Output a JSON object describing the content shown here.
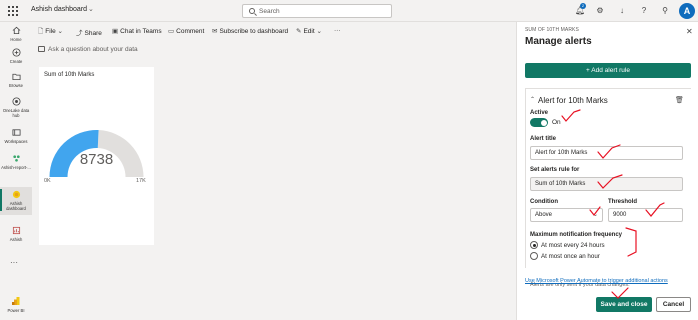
{
  "app": {
    "title": "Ashish dashboard"
  },
  "search": {
    "placeholder": "Search"
  },
  "header": {
    "notification_count": "2",
    "avatar_initial": "A"
  },
  "rail": {
    "items": [
      {
        "label": "Home"
      },
      {
        "label": "Create"
      },
      {
        "label": "Browse"
      },
      {
        "label": "OneLake data hub"
      },
      {
        "label": "Workspaces"
      },
      {
        "label": "Ashish-report-..."
      },
      {
        "label": "Ashish dashboard"
      },
      {
        "label": "Ashish"
      }
    ],
    "more": "···",
    "product": "Power BI"
  },
  "toolbar": {
    "file": "File",
    "share": "Share",
    "chat": "Chat in Teams",
    "comment": "Comment",
    "subscribe": "Subscribe to dashboard",
    "edit": "Edit",
    "more": "···"
  },
  "qa": {
    "placeholder": "Ask a question about your data"
  },
  "tile": {
    "title": "Sum of 10th Marks",
    "value": "8738",
    "min_label": "0K",
    "max_label": "17K",
    "fill_fraction": 0.514,
    "color": "#41a5ee"
  },
  "panel": {
    "subtitle": "SUM OF 10TH MARKS",
    "title": "Manage alerts",
    "add_rule": "+ Add alert rule",
    "rule": {
      "name": "Alert for 10th Marks",
      "active_label": "Active",
      "toggle_text": "On",
      "alert_title_label": "Alert title",
      "alert_title_value": "Alert for 10th Marks",
      "set_rule_label": "Set alerts rule for",
      "set_rule_value": "Sum of 10th Marks",
      "condition_label": "Condition",
      "condition_value": "Above",
      "threshold_label": "Threshold",
      "threshold_value": "9000",
      "frequency_label": "Maximum notification frequency",
      "frequency_options": [
        "At most every 24 hours",
        "At most once an hour"
      ],
      "hint": "Alerts are only sent if your data changes."
    },
    "power_automate_link": "Use Microsoft Power Automate to trigger additional actions",
    "save": "Save and close",
    "cancel": "Cancel"
  },
  "colors": {
    "accent": "#117865",
    "brand": "#0f6cbd",
    "annotation": "#e81123"
  }
}
